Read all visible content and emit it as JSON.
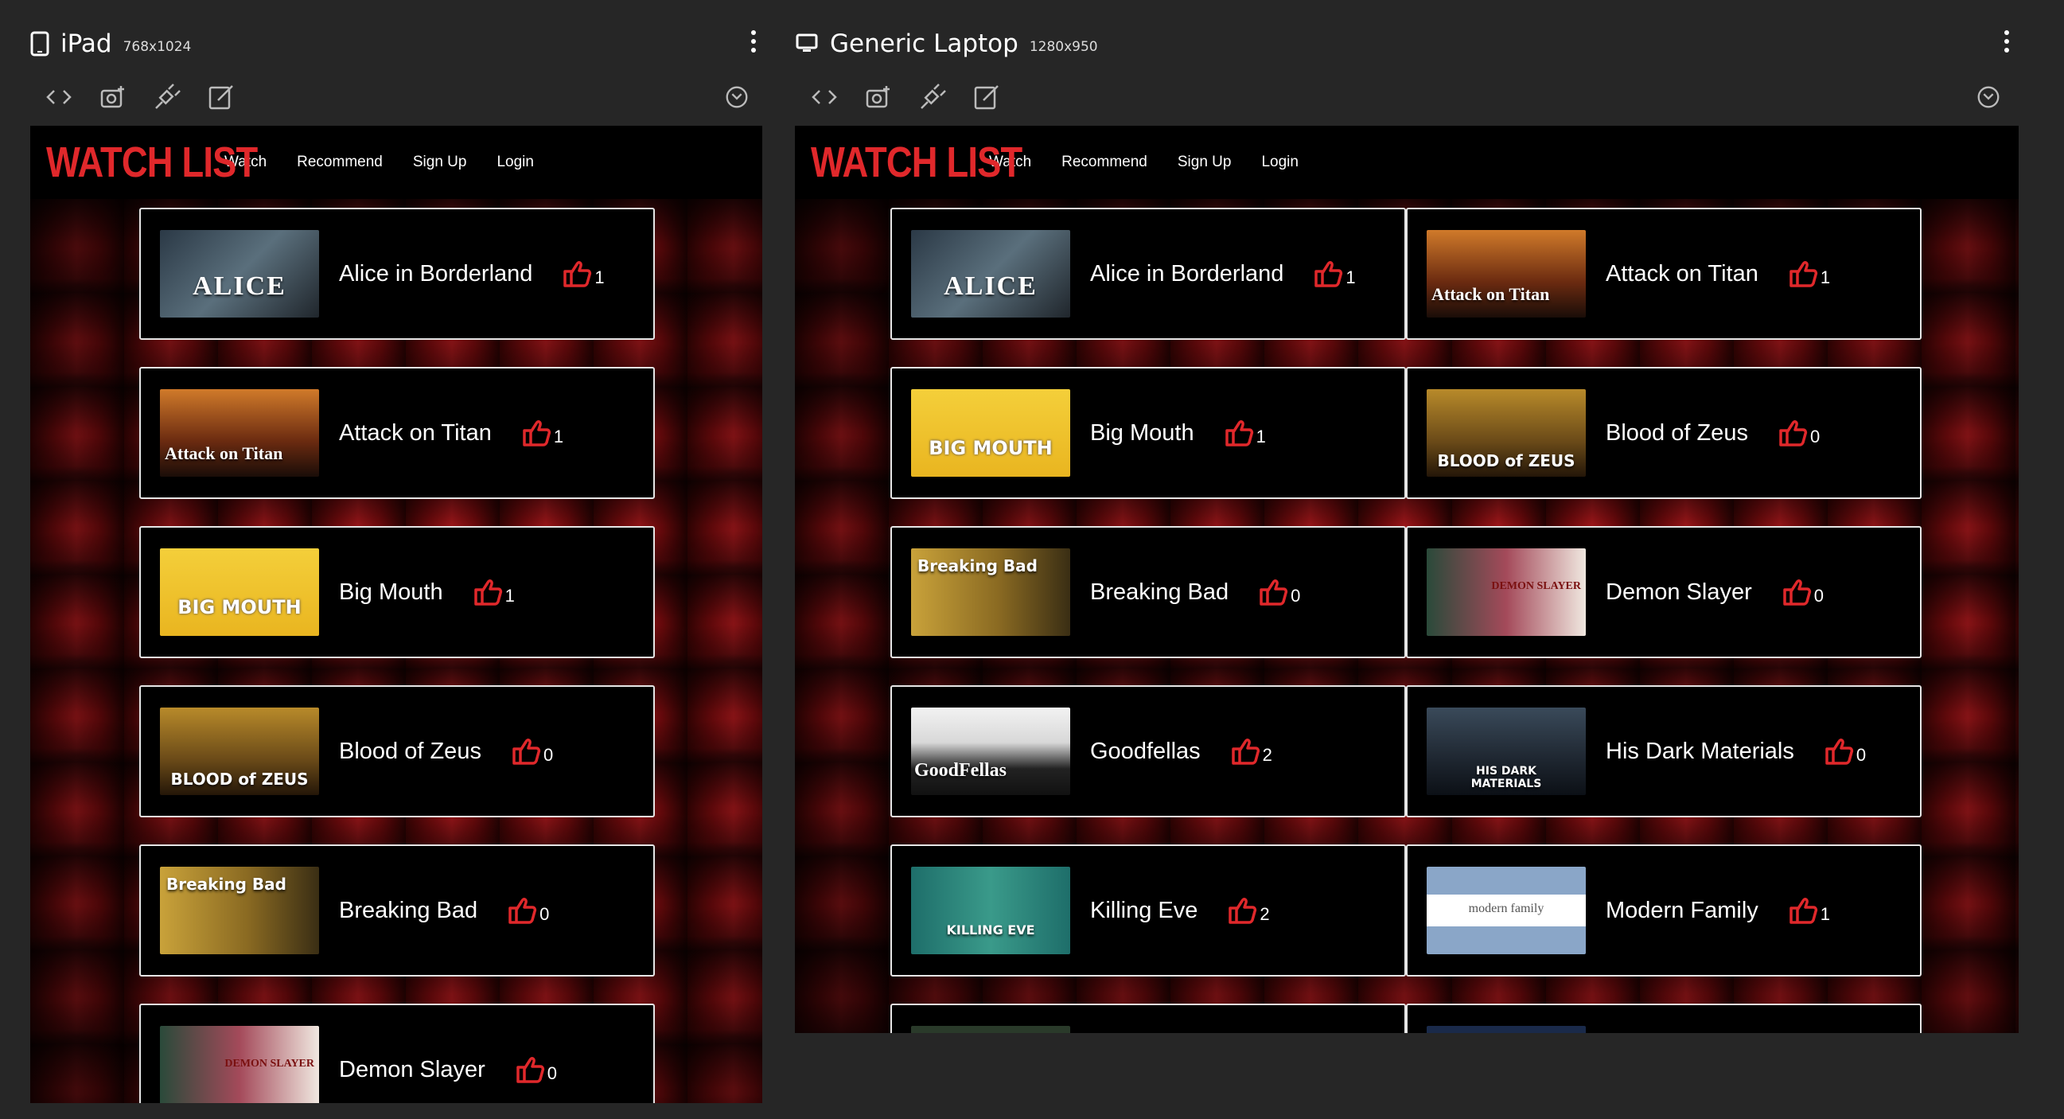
{
  "colors": {
    "brand_red": "#e0282b",
    "chrome_bg": "#262626",
    "card_border": "#e6e6e6"
  },
  "site": {
    "logo": "WATCH LIST",
    "nav": [
      "Watch",
      "Recommend",
      "Sign Up",
      "Login"
    ]
  },
  "devices": [
    {
      "name": "iPad",
      "size": "768x1024",
      "icon": "tablet-icon"
    },
    {
      "name": "Generic Laptop",
      "size": "1280x950",
      "icon": "laptop-icon"
    }
  ],
  "toolbar_icons": [
    "code-icon",
    "camera-icon",
    "plug-icon",
    "edit-icon",
    "rotate-icon"
  ],
  "shows": [
    {
      "title": "Alice in Borderland",
      "likes": "1",
      "poster_text": "ALICE"
    },
    {
      "title": "Attack on Titan",
      "likes": "1",
      "poster_text": "Attack on Titan"
    },
    {
      "title": "Big Mouth",
      "likes": "1",
      "poster_text": "BIG MOUTH"
    },
    {
      "title": "Blood of Zeus",
      "likes": "0",
      "poster_text": "BLOOD of ZEUS"
    },
    {
      "title": "Breaking Bad",
      "likes": "0",
      "poster_text": "Breaking Bad"
    },
    {
      "title": "Demon Slayer",
      "likes": "0",
      "poster_text": "DEMON SLAYER"
    },
    {
      "title": "Goodfellas",
      "likes": "2",
      "poster_text": "GoodFellas"
    },
    {
      "title": "His Dark Materials",
      "likes": "0",
      "poster_text": "HIS DARK MATERIALS"
    },
    {
      "title": "Killing Eve",
      "likes": "2",
      "poster_text": "KILLING EVE"
    },
    {
      "title": "Modern Family",
      "likes": "1",
      "poster_text": "modern family"
    }
  ]
}
